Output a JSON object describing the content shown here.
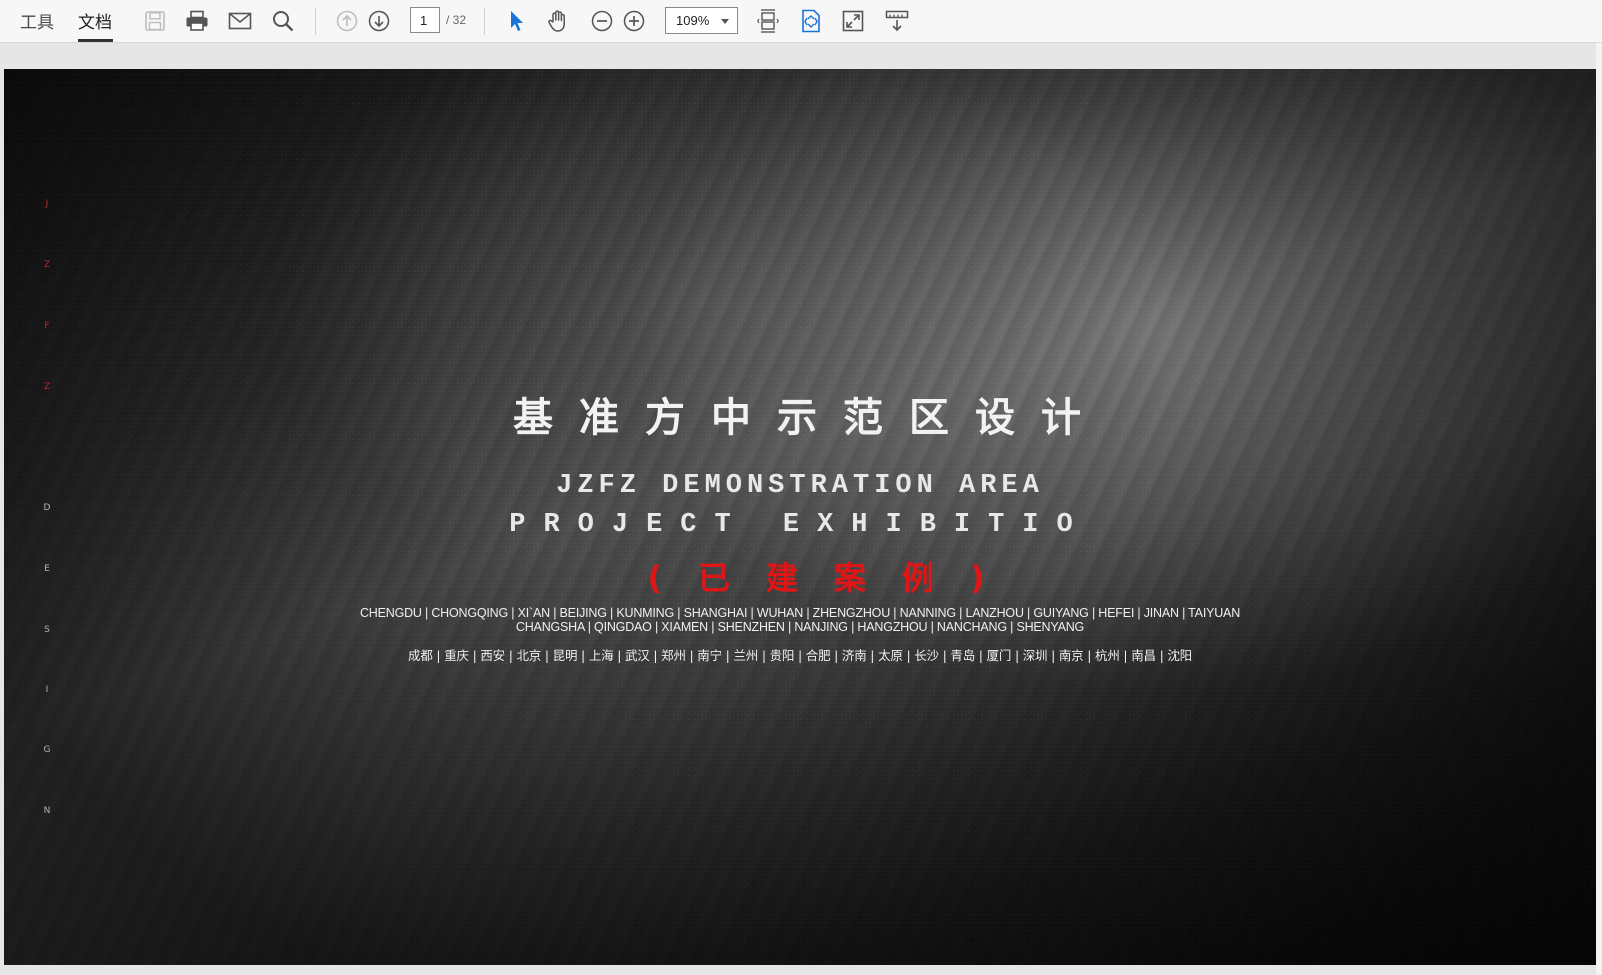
{
  "toolbar": {
    "tabs": [
      {
        "label": "工具"
      },
      {
        "label": "文档"
      }
    ],
    "page_current": "1",
    "page_total": "/ 32",
    "zoom": "109%"
  },
  "document": {
    "side_letters_red": [
      "J",
      "Z",
      "F",
      "Z"
    ],
    "side_letters_gray": [
      "D",
      "E",
      "S",
      "I",
      "G",
      "N"
    ],
    "title_cn": "基准方中示范区设计",
    "title_en_line1": "JZFZ DEMONSTRATION AREA",
    "title_en_line2": "PROJECT EXHIBITIO",
    "subtitle_red": "(已建案例)",
    "cities_en_line1": "CHENGDU | CHONGQING | XI`AN | BEIJING | KUNMING | SHANGHAI | WUHAN | ZHENGZHOU | NANNING | LANZHOU | GUIYANG | HEFEI | JINAN | TAIYUAN",
    "cities_en_line2": "CHANGSHA | QINGDAO | XIAMEN | SHENZHEN | NANJING | HANGZHOU | NANCHANG | SHENYANG",
    "cities_cn": "成都 | 重庆 | 西安 | 北京 | 昆明 | 上海 | 武汉 | 郑州 | 南宁 | 兰州 | 贵阳 | 合肥 | 济南 | 太原 | 长沙 | 青岛 | 厦门 | 深圳 | 南京 | 杭州 | 南昌 | 沈阳"
  },
  "colors": {
    "accent_red": "#e01616",
    "select_blue": "#1a73d9"
  }
}
